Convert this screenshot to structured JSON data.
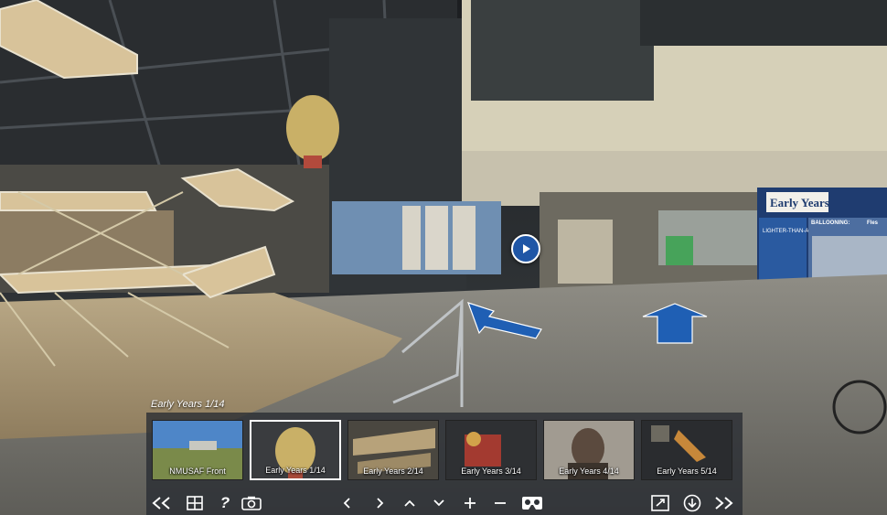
{
  "viewer": {
    "current_scene_label": "Early Years 1/14"
  },
  "tour_sign": {
    "title": "Early Years",
    "panel1": "LIGHTER-THAN-AIR FLIGHT",
    "panel2": "BALLOONING:",
    "panel2b": "Fles"
  },
  "thumbnails": [
    {
      "label": "NMUSAF Front",
      "active": false
    },
    {
      "label": "Early Years 1/14",
      "active": true
    },
    {
      "label": "Early Years 2/14",
      "active": false
    },
    {
      "label": "Early Years 3/14",
      "active": false
    },
    {
      "label": "Early Years 4/14",
      "active": false
    },
    {
      "label": "Early Years 5/14",
      "active": false
    }
  ],
  "toolbar": {
    "first_icon": "double-chevron-left-icon",
    "grid_icon": "grid-icon",
    "help_label": "?",
    "camera_icon": "camera-icon",
    "prev_icon": "chevron-left-icon",
    "next_icon": "chevron-right-icon",
    "up_icon": "chevron-up-icon",
    "down_icon": "chevron-down-icon",
    "zoom_in_icon": "plus-icon",
    "zoom_out_icon": "minus-icon",
    "vr_icon": "vr-goggles-icon",
    "fullscreen_icon": "fullscreen-icon",
    "download_icon": "download-icon",
    "last_icon": "double-chevron-right-icon"
  },
  "colors": {
    "hotspot_blue": "#1f5fb4",
    "panel_bg": "#282c32"
  }
}
